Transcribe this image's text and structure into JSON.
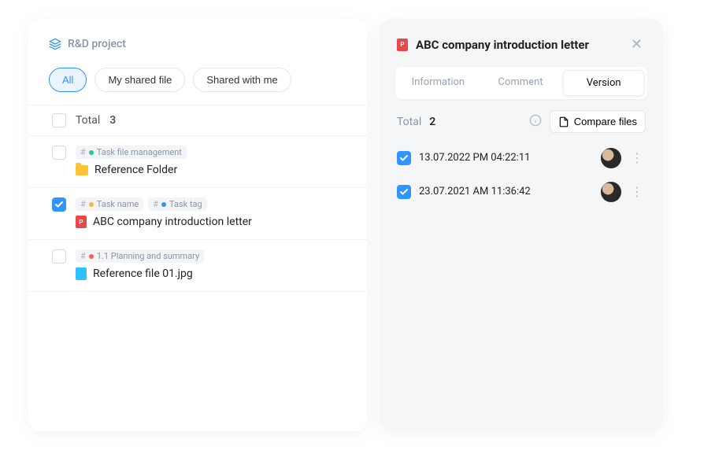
{
  "project": {
    "name": "R&D project"
  },
  "filters": {
    "all": "All",
    "my_shared": "My shared file",
    "shared_with_me": "Shared with me",
    "active": "all"
  },
  "list": {
    "total_label": "Total",
    "total_count": "3",
    "items": [
      {
        "checked": false,
        "tags": [
          {
            "dot": "green",
            "text": "Task file management"
          }
        ],
        "icon": "folder",
        "title": "Reference Folder"
      },
      {
        "checked": true,
        "tags": [
          {
            "dot": "orange",
            "text": "Task name"
          },
          {
            "dot": "blue",
            "text": "Task tag"
          }
        ],
        "icon": "doc-red",
        "title": "ABC company introduction letter"
      },
      {
        "checked": false,
        "tags": [
          {
            "dot": "red",
            "text": "1.1 Planning and summary"
          }
        ],
        "icon": "img-blue",
        "title": "Reference file 01.jpg"
      }
    ]
  },
  "side": {
    "icon_glyph": "P",
    "title": "ABC company introduction letter",
    "tabs": {
      "information": "Information",
      "comment": "Comment",
      "version": "Version",
      "active": "version"
    },
    "total_label": "Total",
    "total_count": "2",
    "compare_label": "Compare files",
    "versions": [
      {
        "checked": true,
        "date": "13.07.2022 PM 04:22:11"
      },
      {
        "checked": true,
        "date": "23.07.2021 AM 11:36:42"
      }
    ]
  }
}
